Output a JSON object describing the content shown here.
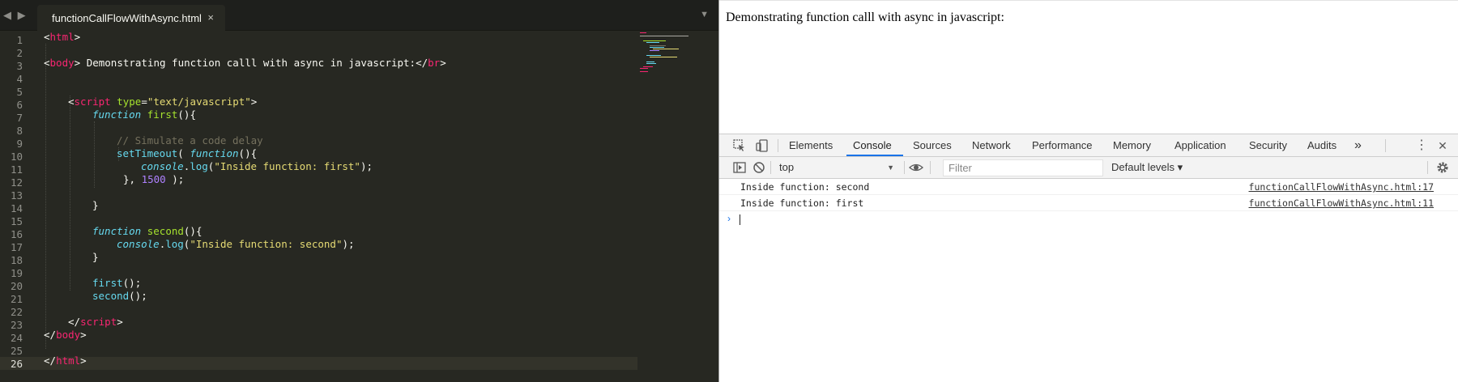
{
  "editor": {
    "tab_label": "functionCallFlowWithAsync.html",
    "tab_close": "×",
    "nav_arrows": "◀ ▶",
    "menu_icon": "▼",
    "active_line": "26",
    "line_numbers": [
      "1",
      "2",
      "3",
      "4",
      "5",
      "6",
      "7",
      "8",
      "9",
      "10",
      "11",
      "12",
      "13",
      "14",
      "15",
      "16",
      "17",
      "18",
      "19",
      "20",
      "21",
      "22",
      "23",
      "24",
      "25",
      "26"
    ],
    "code": {
      "l1": [
        "<",
        "html",
        ">"
      ],
      "l3": [
        "<",
        "body",
        "> Demonstrating function calll with async in javascript:</",
        "br",
        ">"
      ],
      "l6": [
        "<",
        "script",
        " ",
        "type",
        "=",
        "\"text/javascript\"",
        ">"
      ],
      "l7": [
        "function",
        " ",
        "first",
        "(){"
      ],
      "l9": [
        "// Simulate a code delay"
      ],
      "l10": [
        "setTimeout",
        "( ",
        "function",
        "(){"
      ],
      "l11": [
        "console",
        ".",
        "log",
        "(",
        "\"Inside function: first\"",
        ");"
      ],
      "l12": [
        "}, ",
        "1500",
        " );"
      ],
      "l14": [
        "}"
      ],
      "l16": [
        "function",
        " ",
        "second",
        "(){"
      ],
      "l17": [
        "console",
        ".",
        "log",
        "(",
        "\"Inside function: second\"",
        ");"
      ],
      "l18": [
        "}"
      ],
      "l20": [
        "first",
        "();"
      ],
      "l21": [
        "second",
        "();"
      ],
      "l23": [
        "</",
        "script",
        ">"
      ],
      "l24": [
        "</",
        "body",
        ">"
      ],
      "l26": [
        "</",
        "html",
        ">"
      ]
    }
  },
  "page": {
    "text": "Demonstrating function calll with async in javascript:"
  },
  "devtools": {
    "tabs": [
      "Elements",
      "Console",
      "Sources",
      "Network",
      "Performance",
      "Memory",
      "Application",
      "Security",
      "Audits"
    ],
    "selected_tab": "Console",
    "more_tabs_icon": "»",
    "kebab_icon": "⋮",
    "close_icon": "✕",
    "context": "top",
    "filter_placeholder": "Filter",
    "levels_label": "Default levels ▾",
    "messages": [
      {
        "text": "Inside function: second",
        "source": "functionCallFlowWithAsync.html:17"
      },
      {
        "text": "Inside function: first",
        "source": "functionCallFlowWithAsync.html:11"
      }
    ],
    "prompt_symbol": "›",
    "accent_color": "#1a73e8"
  }
}
